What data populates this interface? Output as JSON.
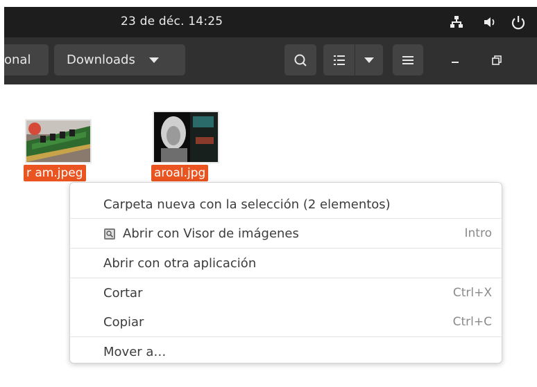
{
  "panel": {
    "clock": "23 de déc.  14:25",
    "network_icon": "network-wired-icon",
    "volume_icon": "volume-icon",
    "power_icon": "power-icon"
  },
  "headerbar": {
    "prev_crumb": "onal",
    "current_folder": "Downloads",
    "search_icon": "search-icon",
    "view_icon": "list-view-icon",
    "view_menu_icon": "chevron-down-icon",
    "menu_icon": "hamburger-menu-icon",
    "minimize_icon": "minimize-icon",
    "maximize_icon": "maximize-icon"
  },
  "files": [
    {
      "name": "r am.jpeg",
      "selected": true
    },
    {
      "name": "aroal.jpg",
      "selected": true
    }
  ],
  "context_menu": {
    "items": [
      {
        "label": "Carpeta nueva con la selección (2 elementos)",
        "accel": ""
      },
      {
        "label": "Abrir con Visor de imágenes",
        "accel": "Intro",
        "icon": "image-viewer-icon"
      },
      {
        "label": "Abrir con otra aplicación",
        "accel": ""
      },
      {
        "label": "Cortar",
        "accel": "Ctrl+X"
      },
      {
        "label": "Copiar",
        "accel": "Ctrl+C"
      },
      {
        "label": "Mover a…",
        "accel": ""
      }
    ]
  },
  "colors": {
    "panel_bg": "#1d1d1d",
    "headerbar_bg": "#303030",
    "button_bg": "#434343",
    "selection_orange": "#e95420"
  }
}
